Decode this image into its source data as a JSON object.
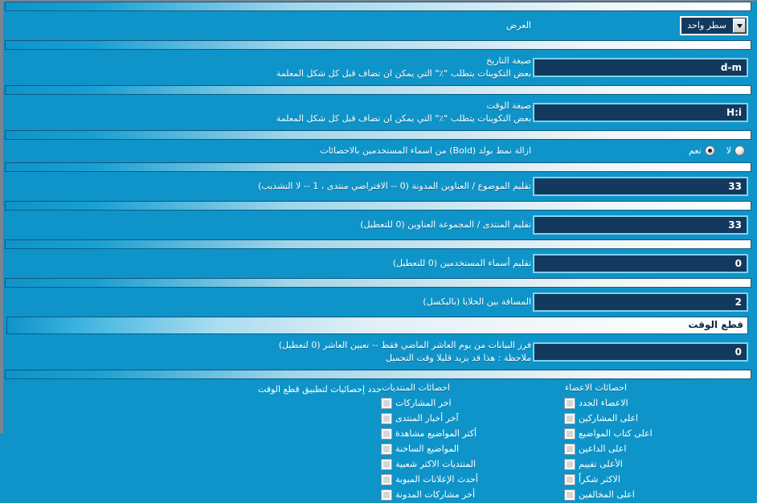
{
  "display_row": {
    "label": "العرض",
    "select": {
      "value": "سطر واحد",
      "arrow_icon": "chevron-down-icon"
    }
  },
  "rows": [
    {
      "label": "صيغة التاريخ",
      "sublabel": "بعض التكوينات يتطلب \"٪\" التي يمكن ان تضاف قبل كل شكل المعلمة",
      "value": "d-m"
    },
    {
      "label": "صيغة الوقت",
      "sublabel": "بعض التكوينات يتطلب \"٪\" التي يمكن ان تضاف قبل كل شكل المعلمة",
      "value": "H:i"
    }
  ],
  "bold_row": {
    "label": "ازالة نمط بولد (Bold) من اسماء المستخدمين بالاحصائات",
    "options": [
      {
        "label": "نعم",
        "selected": true
      },
      {
        "label": "لا",
        "selected": false
      }
    ]
  },
  "numeric_rows": [
    {
      "label": "تقليم الموضوع / العناوين المدونة (0 -- الافتراضي منتدى ، 1 -- لا التشذيب)",
      "value": "33"
    },
    {
      "label": "تقليم المنتدى / المجموعة العناوين (0 للتعطيل)",
      "value": "33"
    },
    {
      "label": "تقليم أسماء المستخدمين (0 للتعطيل)",
      "value": "0"
    },
    {
      "label": "المسافة بين الخلايا (بالبكسل)",
      "value": "2"
    }
  ],
  "section": {
    "title": "قطع الوقت",
    "cutoff_row": {
      "label": "فرز البيانات من يوم العاشر الماضي فقط -- تعيين العاشر (0 لتعطيل)",
      "sublabel": "ملاحظة : هذا قد يزيد قليلا وقت التحميل",
      "value": "0"
    },
    "stats_row": {
      "label": "حدد إحصائيات لتطبيق قطع الوقت",
      "columns": [
        {
          "heading": "احصائات المنتديات",
          "items": [
            {
              "label": "اخر المشاركات",
              "checked": false
            },
            {
              "label": "آخر أخبار المنتدى",
              "checked": false
            },
            {
              "label": "أكثر المواضيع مشاهدة",
              "checked": false
            },
            {
              "label": "المواضيع الساخنة",
              "checked": false
            },
            {
              "label": "المنتديات الاكثر شعبية",
              "checked": false
            },
            {
              "label": "أحدث الإعلانات المبوبة",
              "checked": false
            },
            {
              "label": "أخر مشاركات المدونة",
              "checked": false
            }
          ]
        },
        {
          "heading": "احصائات الاعضاء",
          "items": [
            {
              "label": "الاعضاء الجدد",
              "checked": false
            },
            {
              "label": "اعلى المشاركين",
              "checked": false
            },
            {
              "label": "اعلى كتاب المواضيع",
              "checked": false
            },
            {
              "label": "اعلى الداعين",
              "checked": false
            },
            {
              "label": "الأعلى تقييم",
              "checked": false
            },
            {
              "label": "الاكثر شكراً",
              "checked": false
            },
            {
              "label": "اعلى المخالفين",
              "checked": false
            }
          ]
        }
      ]
    }
  }
}
